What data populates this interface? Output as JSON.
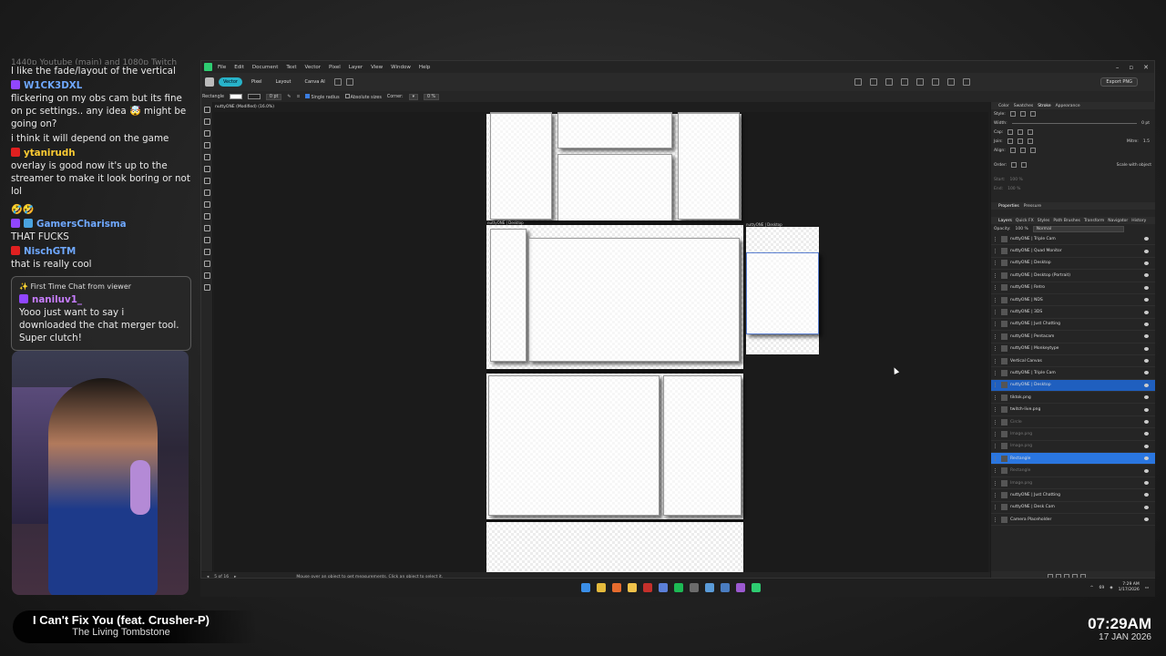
{
  "chat": {
    "cutoff": "1440p Youtube (main) and 1080p Twitch",
    "messages": [
      {
        "platform": "",
        "user": "",
        "text": "I like the fade/layout of the vertical"
      },
      {
        "platform": "twitch",
        "user": "W1CK3DXL",
        "text": "flickering on my obs cam but its fine on pc settings.. any idea 🤯 might be going on?"
      },
      {
        "platform": "",
        "user": "",
        "text": "i think it will depend on the game"
      },
      {
        "platform": "youtube",
        "user": "ytanirudh",
        "text": "overlay is good now it's up to the streamer to make it look boring or not lol"
      },
      {
        "platform": "",
        "user": "",
        "text": "🤣🤣"
      },
      {
        "platform": "twitch",
        "user": "GamersCharisma",
        "text": "THAT FUCKS"
      },
      {
        "platform": "youtube",
        "user": "NischGTM",
        "text": "that is really cool"
      }
    ],
    "first_time": {
      "header": "✨ First Time Chat from viewer",
      "user": "naniluv1_",
      "text": "Yooo just want to say i downloaded the chat merger tool. Super clutch!"
    }
  },
  "now_playing": {
    "title": "I Can't Fix You (feat. Crusher-P)",
    "artist": "The Living Tombstone"
  },
  "overlay_clock": {
    "time": "07:29AM",
    "date": "17 JAN 2026"
  },
  "app": {
    "menu": [
      "File",
      "Edit",
      "Document",
      "Text",
      "Vector",
      "Pixel",
      "Layer",
      "View",
      "Window",
      "Help"
    ],
    "personas": [
      "Vector",
      "Pixel",
      "Layout",
      "Canva AI"
    ],
    "export_label": "Export PNG",
    "context": {
      "tool": "Rectangle",
      "width": "0 pt",
      "single_radius": "Single radius",
      "absolute_sizes": "Absolute sizes",
      "corner": "Corner:",
      "percent": "0 %"
    },
    "doc_tab": "nuttyONE (Modified) (16.0%)",
    "artboard_label_1": "nuttyONE | Desktop",
    "artboard_label_2": "nuttyONE | Desktop",
    "status": {
      "page": "5 of 16",
      "hint": "Mouse over an object to get measurements. Click an object to select it."
    },
    "panel": {
      "tabs": [
        "Color",
        "Swatches",
        "Stroke",
        "Appearance"
      ],
      "active_tab": "Stroke",
      "style_label": "Style:",
      "width_label": "Width:",
      "width_val": "0 pt",
      "cap_label": "Cap:",
      "join_label": "Join:",
      "mitre_label": "Mitre:",
      "mitre_val": "1.5",
      "align_label": "Align:",
      "order_label": "Order:",
      "scale_label": "Scale with object",
      "start_label": "Start:",
      "end_label": "End:",
      "pct1": "100 %",
      "pct2": "100 %",
      "props_tabs": [
        "Properties",
        "Pressure"
      ],
      "layer_tabs": [
        "Layers",
        "Quick FX",
        "Styles",
        "Path Brushes",
        "Transform",
        "Navigator",
        "History"
      ],
      "opacity_label": "Opacity:",
      "opacity_val": "100 %",
      "blend": "Normal"
    },
    "layers": [
      {
        "name": "nuttyONE | Triple Cam",
        "state": ""
      },
      {
        "name": "nuttyONE | Quad Monitor",
        "state": ""
      },
      {
        "name": "nuttyONE | Desktop",
        "state": ""
      },
      {
        "name": "nuttyONE | Desktop (Portrait)",
        "state": ""
      },
      {
        "name": "nuttyONE | Retro",
        "state": ""
      },
      {
        "name": "nuttyONE | NDS",
        "state": ""
      },
      {
        "name": "nuttyONE | 3DS",
        "state": ""
      },
      {
        "name": "nuttyONE | Just Chatting",
        "state": ""
      },
      {
        "name": "nuttyONE | Pentacam",
        "state": ""
      },
      {
        "name": "nuttyONE | Monkeytype",
        "state": ""
      },
      {
        "name": "Vertical Canvas",
        "state": "group"
      },
      {
        "name": "nuttyONE | Triple Cam",
        "state": ""
      },
      {
        "name": "nuttyONE | Desktop",
        "state": "sel"
      },
      {
        "name": "tiktok.png",
        "state": ""
      },
      {
        "name": "twitch-live.png",
        "state": ""
      },
      {
        "name": "Circle",
        "state": "dim"
      },
      {
        "name": "Image.png",
        "state": "dim"
      },
      {
        "name": "Image.png",
        "state": "dim"
      },
      {
        "name": "Rectangle",
        "state": "sel2"
      },
      {
        "name": "Rectangle",
        "state": "dim"
      },
      {
        "name": "Image.png",
        "state": "dim"
      },
      {
        "name": "nuttyONE | Just Chatting",
        "state": ""
      },
      {
        "name": "nuttyONE | Desk Cam",
        "state": ""
      },
      {
        "name": "Camera Placeholder",
        "state": "group"
      }
    ]
  },
  "taskbar": {
    "temp": "69",
    "time": "7:29 AM",
    "date": "1/17/2026"
  }
}
